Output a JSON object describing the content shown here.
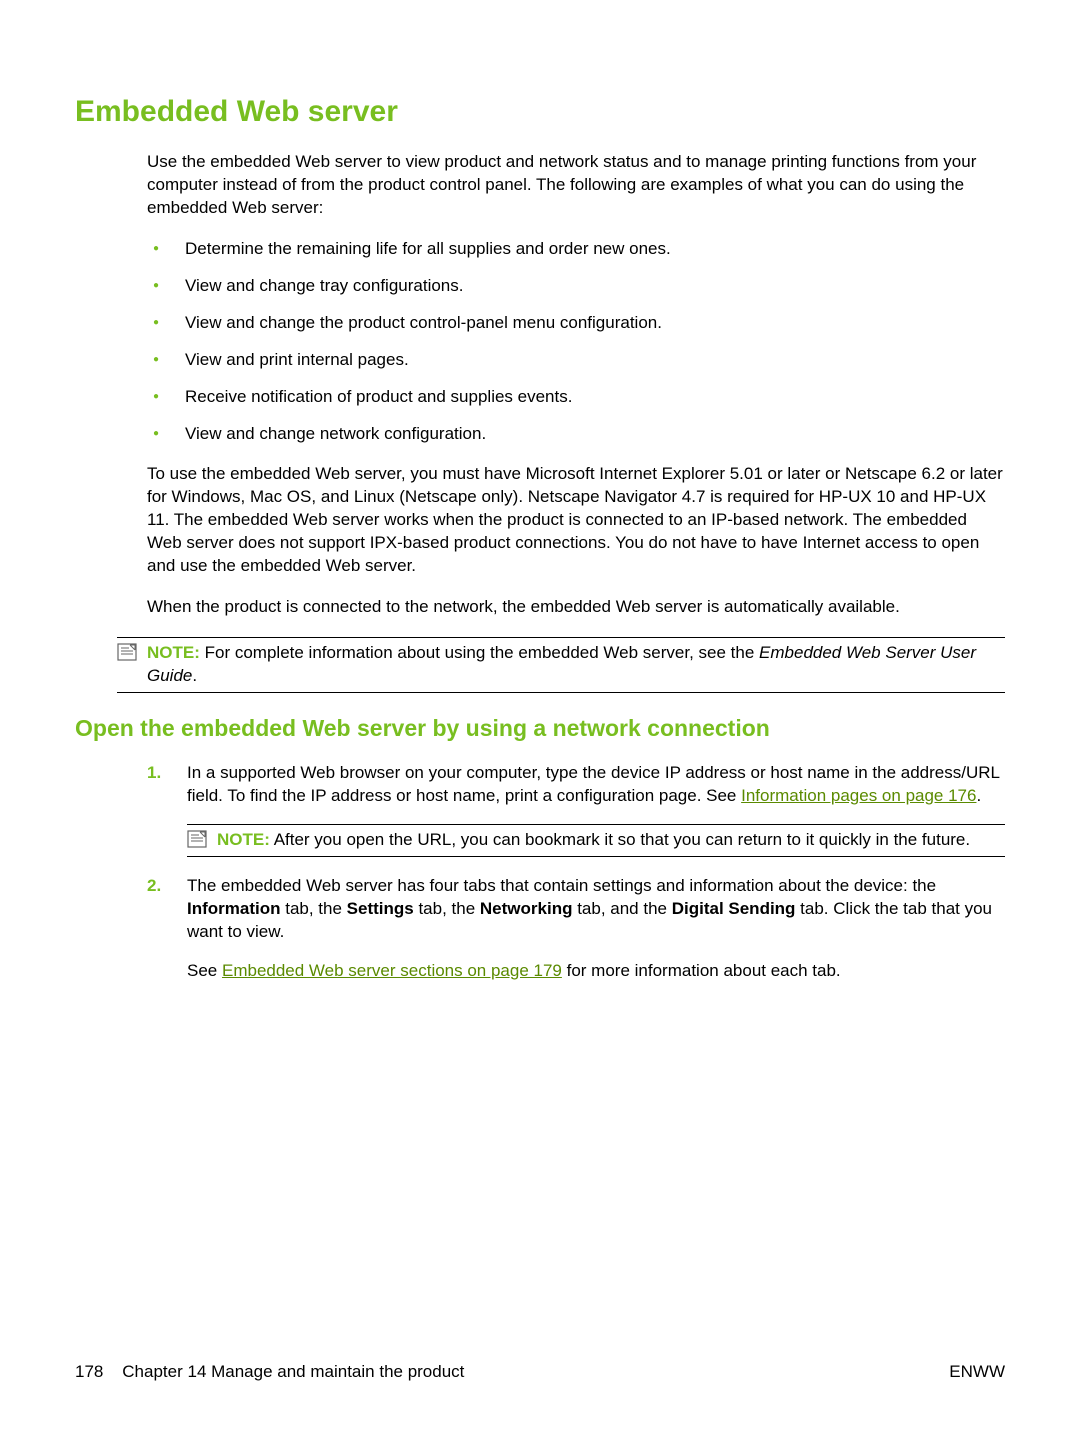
{
  "heading": "Embedded Web server",
  "intro": "Use the embedded Web server to view product and network status and to manage printing functions from your computer instead of from the product control panel. The following are examples of what you can do using the embedded Web server:",
  "bullets": [
    "Determine the remaining life for all supplies and order new ones.",
    "View and change tray configurations.",
    "View and change the product control-panel menu configuration.",
    "View and print internal pages.",
    "Receive notification of product and supplies events.",
    "View and change network configuration."
  ],
  "para2": "To use the embedded Web server, you must have Microsoft Internet Explorer 5.01 or later or Netscape 6.2 or later for Windows, Mac OS, and Linux (Netscape only). Netscape Navigator 4.7 is required for HP-UX 10 and HP-UX 11. The embedded Web server works when the product is connected to an IP-based network. The embedded Web server does not support IPX-based product connections. You do not have to have Internet access to open and use the embedded Web server.",
  "para3": "When the product is connected to the network, the embedded Web server is automatically available.",
  "note1": {
    "label": "NOTE:",
    "text_pre": "For complete information about using the embedded Web server, see the ",
    "italic": "Embedded Web Server User Guide",
    "text_post": "."
  },
  "subheading": "Open the embedded Web server by using a network connection",
  "steps": {
    "s1": {
      "num": "1.",
      "text_pre": "In a supported Web browser on your computer, type the device IP address or host name in the address/URL field. To find the IP address or host name, print a configuration page. See ",
      "link": "Information pages on page 176",
      "text_post": ".",
      "note": {
        "label": "NOTE:",
        "text": "After you open the URL, you can bookmark it so that you can return to it quickly in the future."
      }
    },
    "s2": {
      "num": "2.",
      "text_a": "The embedded Web server has four tabs that contain settings and information about the device: the ",
      "b1": "Information",
      "text_b": " tab, the ",
      "b2": "Settings",
      "text_c": " tab, the ",
      "b3": "Networking",
      "text_d": " tab, and the ",
      "b4": "Digital Sending",
      "text_e": " tab. Click the tab that you want to view.",
      "para2_pre": "See ",
      "para2_link": "Embedded Web server sections on page 179",
      "para2_post": " for more information about each tab."
    }
  },
  "footer": {
    "page_num": "178",
    "chapter": "Chapter 14   Manage and maintain the product",
    "right": "ENWW"
  }
}
